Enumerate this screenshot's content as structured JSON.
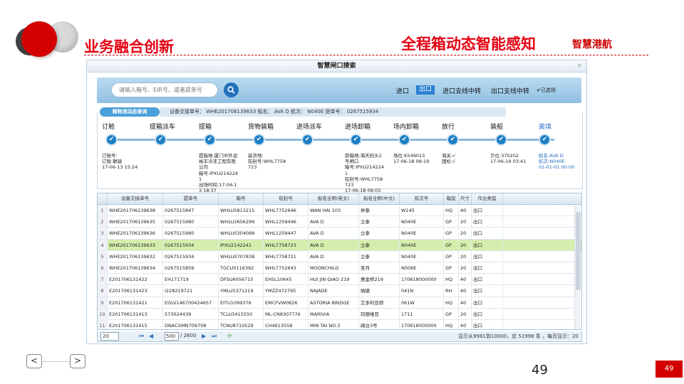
{
  "slide": {
    "title_left": "业务融合创新",
    "title_right": "全程箱动态智能感知",
    "brand": "智慧港航",
    "page_number": "49",
    "page_badge": "49",
    "prev_label": "<",
    "next_label": ">"
  },
  "window": {
    "title": "智慧闸口搜索",
    "close_label": "×",
    "search_placeholder": "请输入箱号、EIR号、或者提单号",
    "nav": [
      "进口",
      "出口",
      "进口支线中转",
      "出口支线中转"
    ],
    "nav_active": "出口",
    "nav_check": "已选场"
  },
  "tracking": {
    "tab_label": "箱物流动态查询",
    "info": "设备交接单号： WHE201706139633  船名： AVA D  航次： N040E  提单号： 0267515934",
    "stages": [
      "订舱",
      "提箱派车",
      "提箱",
      "货物装箱",
      "进场派车",
      "进场卸箱",
      "场内卸箱",
      "放行",
      "装船",
      "离境"
    ],
    "details": [
      "订舱号:\n订舱:联骏\n17-06-13 15:24",
      "",
      "提箱地:厦门中外运\n裕丰冷冻工程有限\n公司\n箱号:IPXU214224\n1\n出场时间:17-06-1\n3 18:37",
      "装货地:\n铅封号:WHL7758\n723",
      "",
      "卸箱地:海天码头2\n号闸口\n箱号:IPXU214224\n1\n铅封号:WHL7758\n723\n17-06-18 08:03",
      "场位:K549013\n17-06-18 08:19",
      "海关:√\n国检:√",
      "贝位:370202\n17-06-19 03:41",
      "船名:AVA D\n航次:N040E\n01-01-01 00:00"
    ]
  },
  "grid": {
    "headers": [
      "",
      "设备交接单号",
      "提单号",
      "箱号",
      "铅封号",
      "船名全称(英文)",
      "船名全称(中文)",
      "航次号",
      "箱型",
      "尺寸",
      "作业类型"
    ],
    "rows": [
      [
        "1",
        "WHE201706139638",
        "0267515847",
        "WHLU5813215",
        "WHL7752646",
        "WAN HAI 103",
        "昇泰",
        "W145",
        "HQ",
        "40",
        "出口"
      ],
      [
        "2",
        "WHE201706139635",
        "0267515980",
        "WHLU2656299",
        "WHL1259446",
        "AVA D",
        "立泰",
        "N040E",
        "GP",
        "20",
        "出口"
      ],
      [
        "3",
        "WHE201706139636",
        "0267515980",
        "WHLU0304088",
        "WHL1259447",
        "AVA D",
        "立泰",
        "N040E",
        "GP",
        "20",
        "出口"
      ],
      [
        "4",
        "WHE201706139633",
        "0267515934",
        "IPXU2142241",
        "WHL7758723",
        "AVA D",
        "立泰",
        "N040E",
        "GP",
        "20",
        "出口"
      ],
      [
        "5",
        "WHE201706139632",
        "0267515934",
        "WHLU0707838",
        "WHL7758721",
        "AVA D",
        "立泰",
        "N040E",
        "GP",
        "20",
        "出口"
      ],
      [
        "6",
        "WHE201706139634",
        "0267515859",
        "TGCU0116392",
        "WHL7752643",
        "MOONCHILD",
        "圣月",
        "N006E",
        "GP",
        "20",
        "出口"
      ],
      [
        "7",
        "E201706131422",
        "EH171719",
        "DFSU6056715",
        "EHSL10645",
        "HUI JIN QIAO 219",
        "惠金桥219",
        "170618000000",
        "HQ",
        "40",
        "出口"
      ],
      [
        "8",
        "E201706131423",
        "I228219721",
        "YMLU5371219",
        "YMZZ472795",
        "NAJADE",
        "纳捷",
        "041N",
        "RH",
        "40",
        "出口"
      ],
      [
        "9",
        "E201706131421",
        "EGLV146700424657",
        "EITU1099376",
        "EMCFVW0826",
        "ASTORIA BRIDGE",
        "艾多利亚桥",
        "061W",
        "HQ",
        "40",
        "出口"
      ],
      [
        "10",
        "E201706131413",
        "573024439",
        "TCLU3415550",
        "ML-CN8307776",
        "MARIVIA",
        "玛丽维亚",
        "1711",
        "GP",
        "20",
        "出口"
      ],
      [
        "11",
        "E201706131415",
        "DNACXMN709708",
        "TCNU8710529",
        "CH4613558",
        "MIN TAI NO.3",
        "闽台3号",
        "170618000000",
        "HQ",
        "40",
        "出口"
      ]
    ],
    "selected_row": 3
  },
  "pager": {
    "page_size": "20",
    "current": "500",
    "total": "/ 2600",
    "info": "显示从9981到10000，总 51998 条 ，每页显示：20"
  }
}
